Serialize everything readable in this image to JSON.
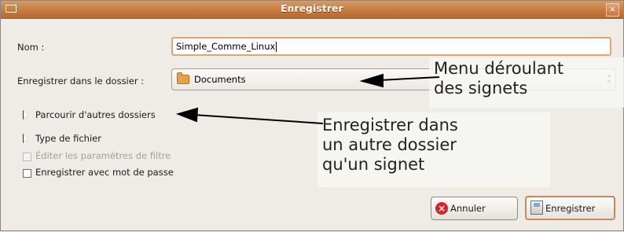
{
  "window": {
    "title": "Enregistrer",
    "close_glyph": "×",
    "accent": "#c77a3f"
  },
  "form": {
    "name_label": "Nom :",
    "name_value": "Simple_Comme_Linux",
    "folder_label": "Enregistrer dans le dossier :",
    "folder_value": "Documents",
    "folder_icon": "folder-icon"
  },
  "expanders": {
    "browse": "Parcourir d'autres dossiers",
    "file_type": "Type de fichier"
  },
  "options": {
    "edit_filter": {
      "label": "Éditer les paramètres de filtre",
      "disabled": true,
      "checked": false
    },
    "password": {
      "label": "Enregistrer avec mot de passe",
      "checked": false
    }
  },
  "annotations": {
    "menu_line1": "Menu déroulant",
    "menu_line2": "des signets",
    "save_line1": "Enregistrer dans",
    "save_line2": "un autre dossier",
    "save_line3": "qu'un signet"
  },
  "buttons": {
    "cancel": {
      "label": "Annuler",
      "icon": "cancel-icon"
    },
    "save": {
      "label": "Enregistrer",
      "icon": "save-icon"
    }
  }
}
